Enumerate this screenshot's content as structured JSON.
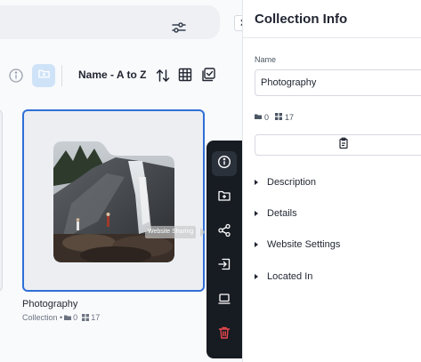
{
  "toolbar": {
    "sort_label": "Name - A to Z"
  },
  "card": {
    "title": "Photography",
    "type_label": "Collection •",
    "folder_count": "0",
    "item_count": "17"
  },
  "tooltip": {
    "text": "Website Sharing"
  },
  "side_toolbar": {
    "buttons": [
      "info",
      "add-to-folder",
      "share",
      "move",
      "present",
      "delete"
    ],
    "active": "info"
  },
  "panel": {
    "title": "Collection Info",
    "name_label": "Name",
    "name_value": "Photography",
    "folder_count": "0",
    "item_count": "17",
    "sections": [
      "Description",
      "Details",
      "Website Settings",
      "Located In"
    ]
  },
  "colors": {
    "accent": "#2f6fd6",
    "delete": "#e5484d",
    "dark_toolbar": "#171b22"
  }
}
